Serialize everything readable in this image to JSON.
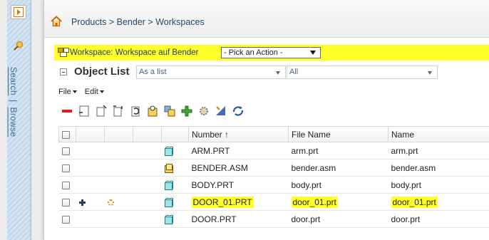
{
  "breadcrumb": {
    "items": [
      "Products",
      "Bender",
      "Workspaces"
    ],
    "separator": ">"
  },
  "sidebar": {
    "search": "Search",
    "browse": "Browse",
    "divider": "|"
  },
  "workspace": {
    "label": "Workspace: Workspace auf Bender",
    "action_select": "- Pick an Action -"
  },
  "object_list": {
    "title": "Object List",
    "view_select": "As a list",
    "filter_select": "All"
  },
  "menus": {
    "file": "File",
    "edit": "Edit"
  },
  "toolbar_icons": [
    "remove-icon",
    "new-document-icon",
    "new-document-2-icon",
    "new-document-3-icon",
    "undo-checkout-icon",
    "checkout-icon",
    "add-to-workspace-icon",
    "add-icon",
    "update-settings-icon",
    "edit-attributes-icon",
    "refresh-icon"
  ],
  "colors": {
    "highlight": "#ffff29",
    "header_bg": "#ffff29",
    "link": "#23476f"
  },
  "table": {
    "headers": {
      "number": "Number",
      "sort_indicator": "↑",
      "file_name": "File Name",
      "name": "Name"
    },
    "rows": [
      {
        "number": "ARM.PRT",
        "file_name": "arm.prt",
        "name": "arm.prt",
        "icon": "part-icon",
        "highlight": false
      },
      {
        "number": "BENDER.ASM",
        "file_name": "bender.asm",
        "name": "bender.asm",
        "icon": "assembly-icon",
        "highlight": false
      },
      {
        "number": "BODY.PRT",
        "file_name": "body.prt",
        "name": "body.prt",
        "icon": "part-icon",
        "highlight": false
      },
      {
        "number": "DOOR_01.PRT",
        "file_name": "door_01.prt",
        "name": "door_01.prt",
        "icon": "part-icon",
        "highlight": true,
        "status_icons": [
          "plus-icon",
          "modified-icon"
        ]
      },
      {
        "number": "DOOR.PRT",
        "file_name": "door.prt",
        "name": "door.prt",
        "icon": "part-icon",
        "highlight": false
      }
    ]
  }
}
